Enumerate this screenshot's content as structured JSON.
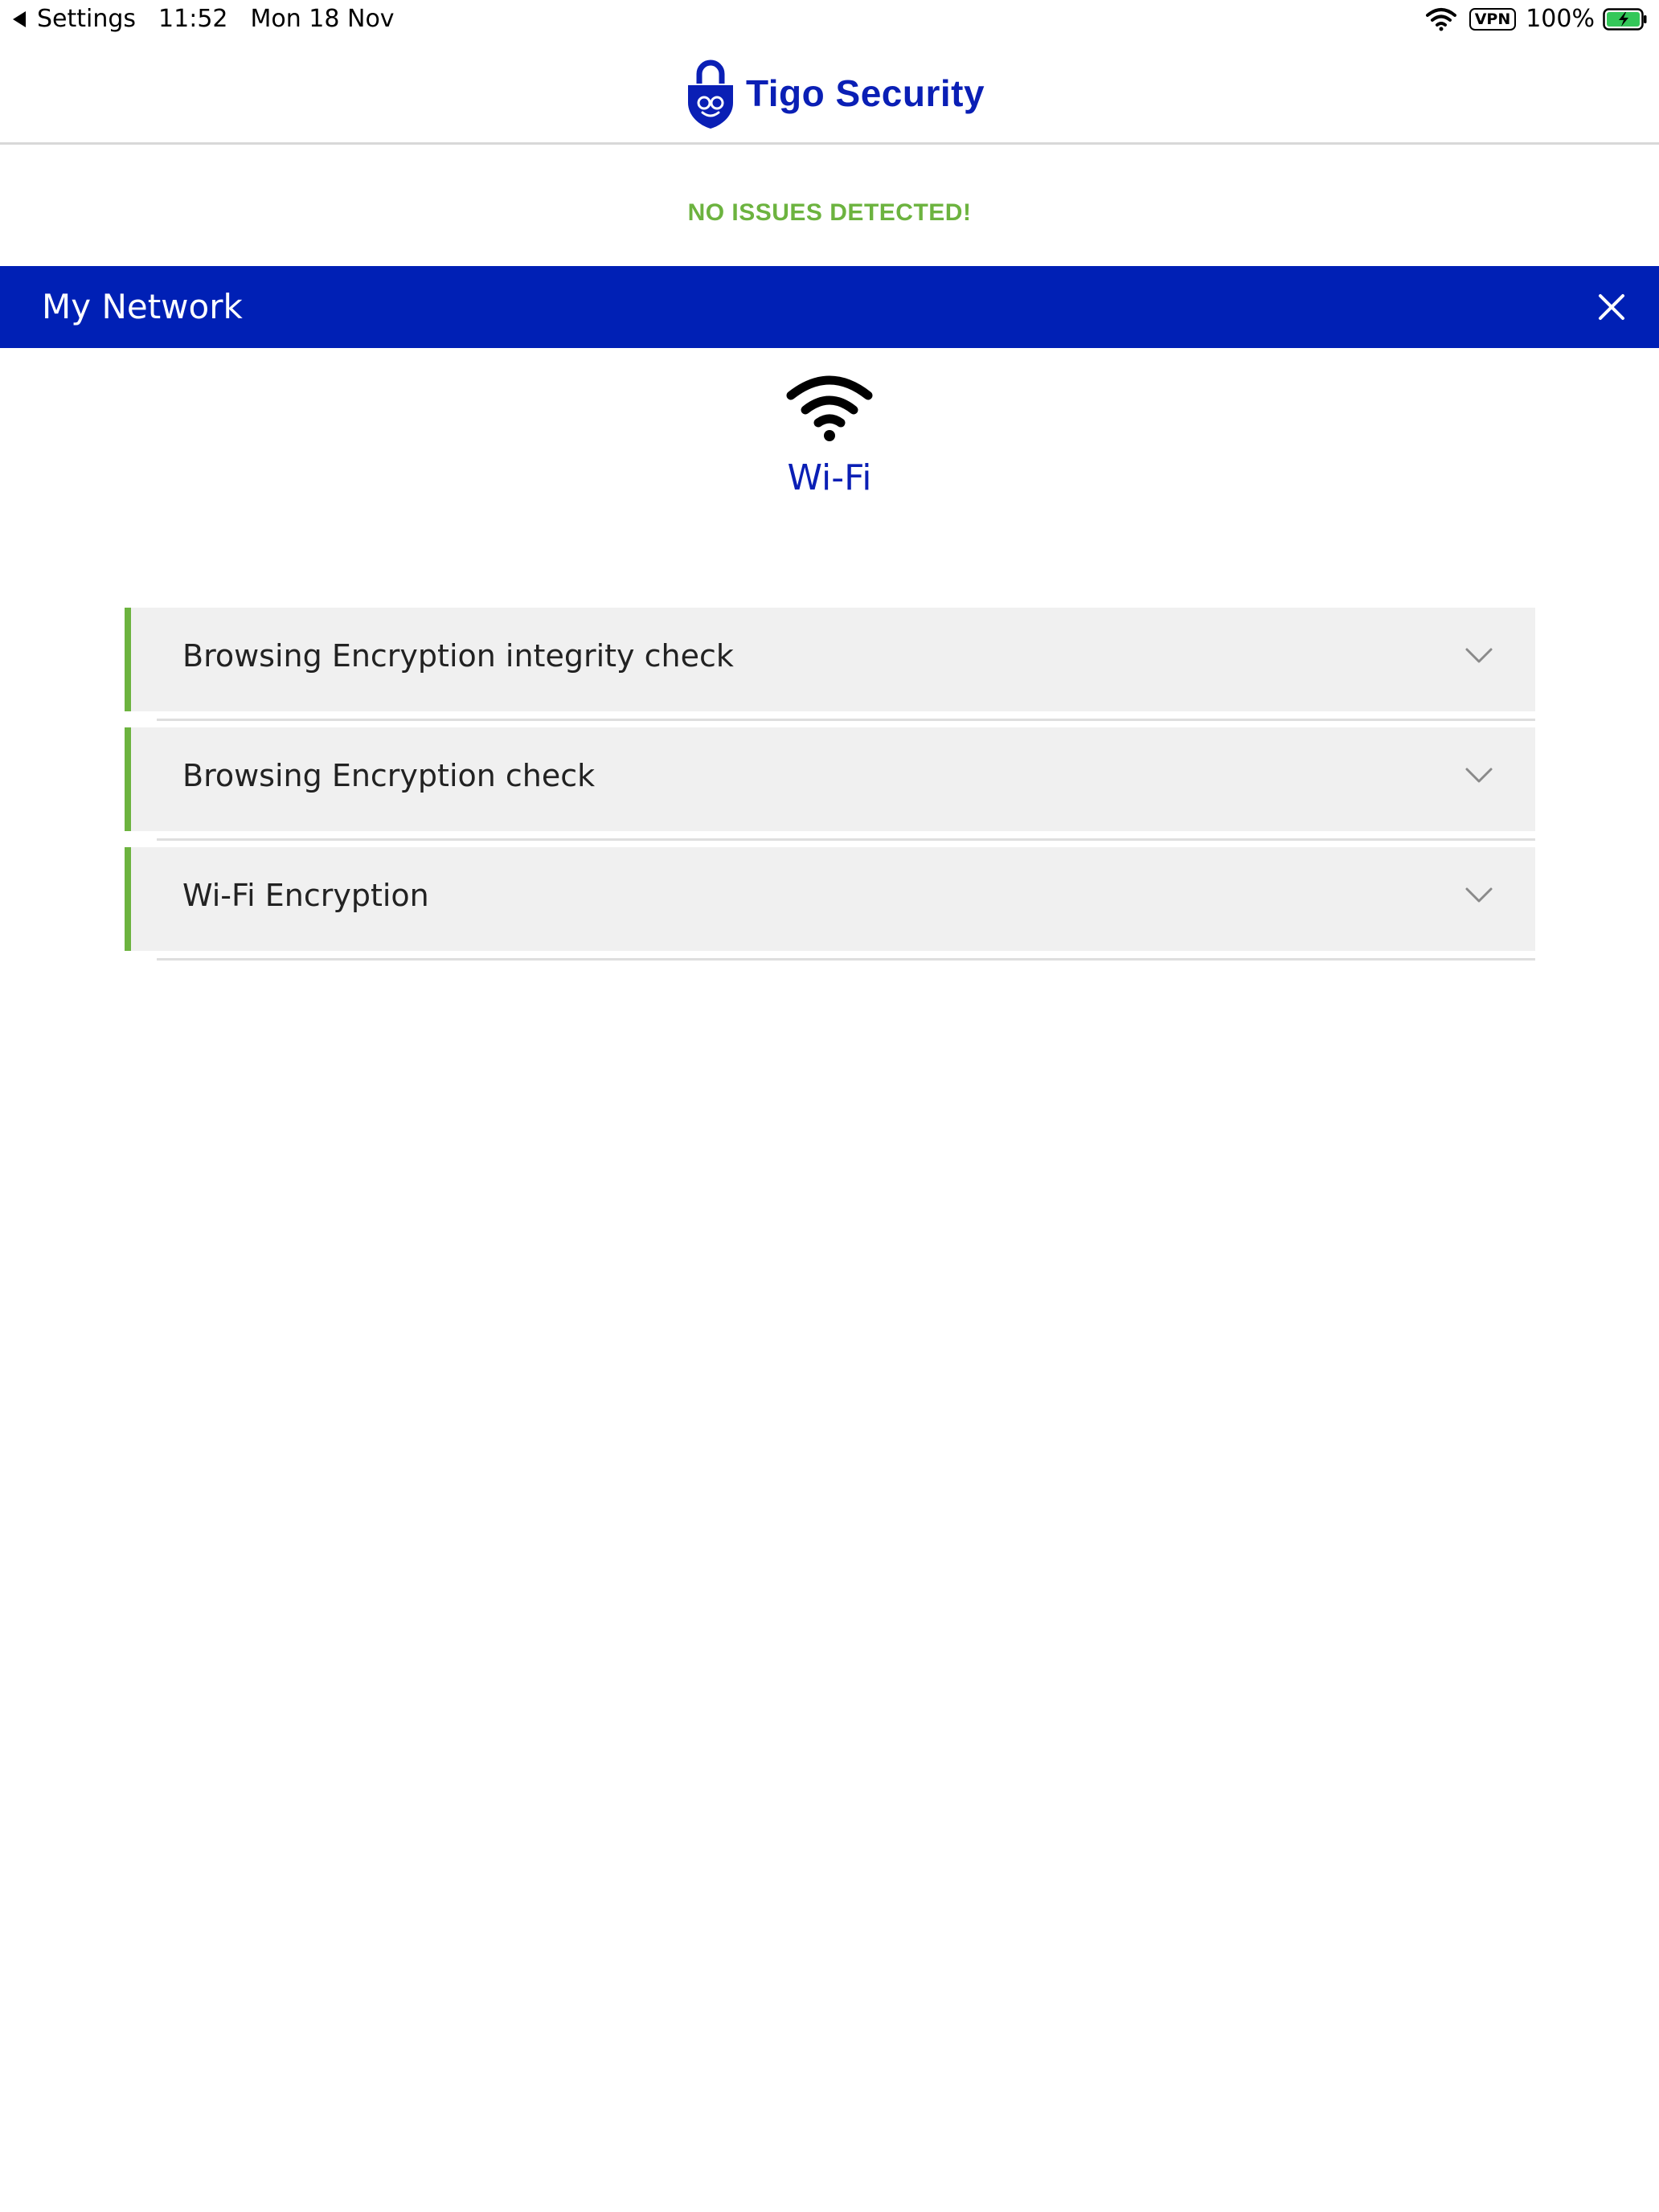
{
  "status_bar": {
    "back_label": "Settings",
    "time": "11:52",
    "date": "Mon 18 Nov",
    "vpn": "VPN",
    "battery": "100%"
  },
  "header": {
    "logo_text": "Tigo Security",
    "logo_icon": "padlock-icon",
    "brand_color": "#0a1fb5"
  },
  "status_message": "NO ISSUES DETECTED!",
  "section": {
    "title": "My Network",
    "close_icon": "close-icon",
    "bar_color": "#0020b5"
  },
  "network": {
    "icon": "wifi-icon",
    "label": "Wi-Fi"
  },
  "checks": [
    {
      "label": "Browsing Encryption integrity check",
      "status": "ok",
      "status_color": "#6cb33f"
    },
    {
      "label": "Browsing Encryption check",
      "status": "ok",
      "status_color": "#6cb33f"
    },
    {
      "label": "Wi-Fi Encryption",
      "status": "ok",
      "status_color": "#6cb33f"
    }
  ]
}
